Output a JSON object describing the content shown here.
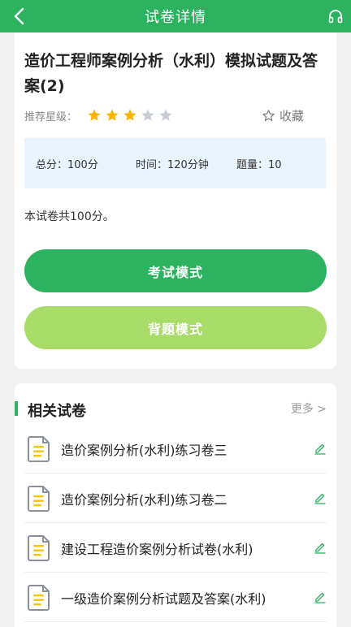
{
  "header": {
    "title": "试卷详情"
  },
  "paper": {
    "title": "造价工程师案例分析（水利）模拟试题及答案(2)",
    "rating_label": "推荐星级：",
    "rating": 3,
    "rating_max": 5,
    "favorite_label": "收藏",
    "total_score": "总分：100分",
    "time": "时间：120分钟",
    "question_count": "题量：10",
    "description": "本试卷共100分。"
  },
  "actions": {
    "exam_mode": "考试模式",
    "study_mode": "背题模式"
  },
  "related": {
    "title": "相关试卷",
    "more": "更多 >",
    "items": [
      "造价案例分析(水利)练习卷三",
      "造价案例分析(水利)练习卷二",
      "建设工程造价案例分析试卷(水利)",
      "一级造价案例分析试题及答案(水利)"
    ]
  },
  "colors": {
    "primary": "#2db35f",
    "secondary_button": "#a6dc67",
    "star_filled": "#f7b500",
    "star_empty": "#c9cdd6",
    "info_bg": "#e9f3fd"
  },
  "icons": {
    "back": "chevron-left-icon",
    "audio": "headphones-icon",
    "favorite": "star-outline-icon",
    "document": "document-icon",
    "edit": "pencil-icon"
  }
}
